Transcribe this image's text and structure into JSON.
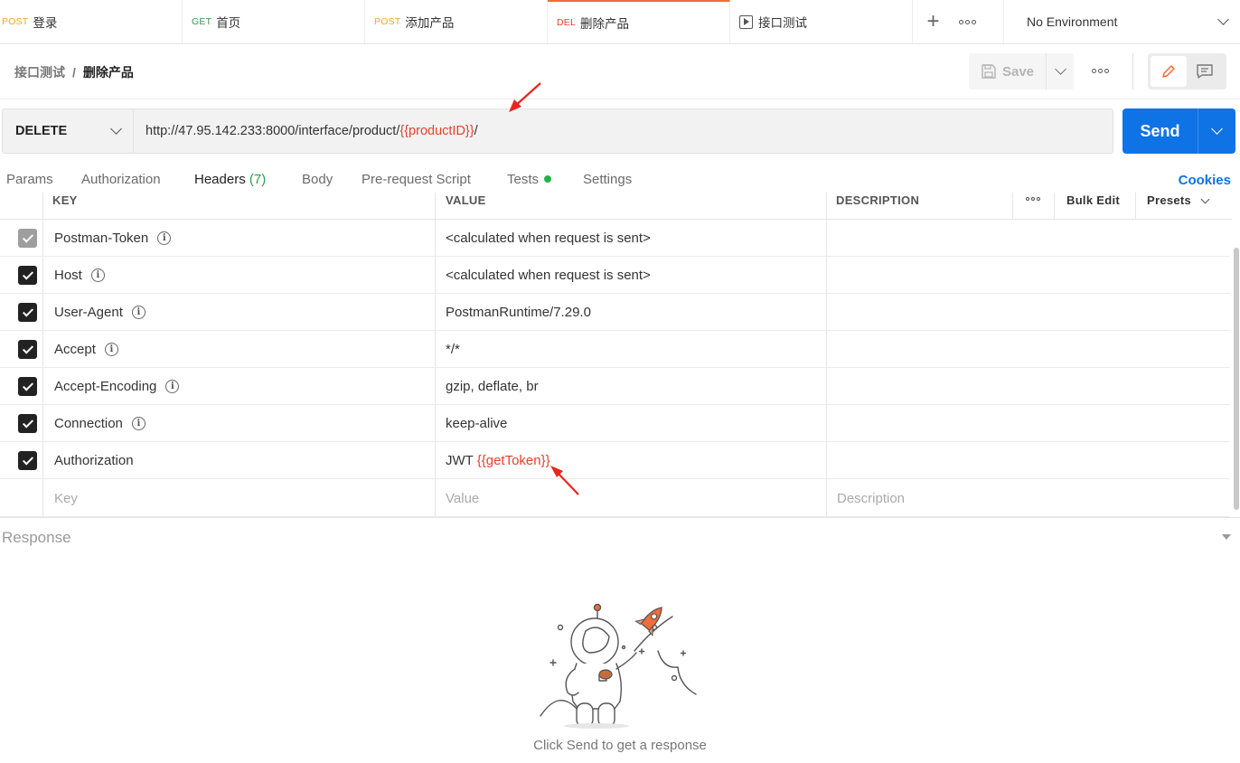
{
  "tabs": [
    {
      "method": "POST",
      "method_color": "#f5a623",
      "name": "登录"
    },
    {
      "method": "GET",
      "method_color": "#2a9d50",
      "name": "首页"
    },
    {
      "method": "POST",
      "method_color": "#f5a623",
      "name": "添加产品"
    },
    {
      "method": "DEL",
      "method_color": "#e5422b",
      "name": "删除产品"
    },
    {
      "name": "接口测试"
    }
  ],
  "environment": "No Environment",
  "breadcrumb": {
    "parent": "接口测试",
    "separator": "/",
    "current": "删除产品"
  },
  "save_label": "Save",
  "request": {
    "method": "DELETE",
    "url_prefix": "http://47.95.142.233:8000/interface/product/",
    "url_variable": "{{productID}}",
    "url_suffix": "/"
  },
  "send_label": "Send",
  "request_tabs": {
    "params": "Params",
    "authorization": "Authorization",
    "headers": "Headers",
    "headers_count": "(7)",
    "body": "Body",
    "prerequest": "Pre-request Script",
    "tests": "Tests",
    "settings": "Settings",
    "cookies": "Cookies"
  },
  "table": {
    "columns": {
      "key": "KEY",
      "value": "VALUE",
      "description": "DESCRIPTION",
      "bulk_edit": "Bulk Edit",
      "presets": "Presets"
    },
    "rows": [
      {
        "key": "Postman-Token",
        "value": "<calculated when request is sent>"
      },
      {
        "key": "Host",
        "value": "<calculated when request is sent>"
      },
      {
        "key": "User-Agent",
        "value": "PostmanRuntime/7.29.0"
      },
      {
        "key": "Accept",
        "value": "*/*"
      },
      {
        "key": "Accept-Encoding",
        "value": "gzip, deflate, br"
      },
      {
        "key": "Connection",
        "value": "keep-alive"
      },
      {
        "key": "Authorization",
        "value_prefix": "JWT ",
        "value_variable": "{{getToken}}"
      }
    ],
    "placeholders": {
      "key": "Key",
      "value": "Value",
      "description": "Description"
    }
  },
  "response": {
    "title": "Response",
    "hint": "Click Send to get a response"
  },
  "colors": {
    "accent": "#f26b3a",
    "send": "#0f73e6",
    "variable": "#e5422b",
    "annotation_arrow": "#e8261e"
  }
}
